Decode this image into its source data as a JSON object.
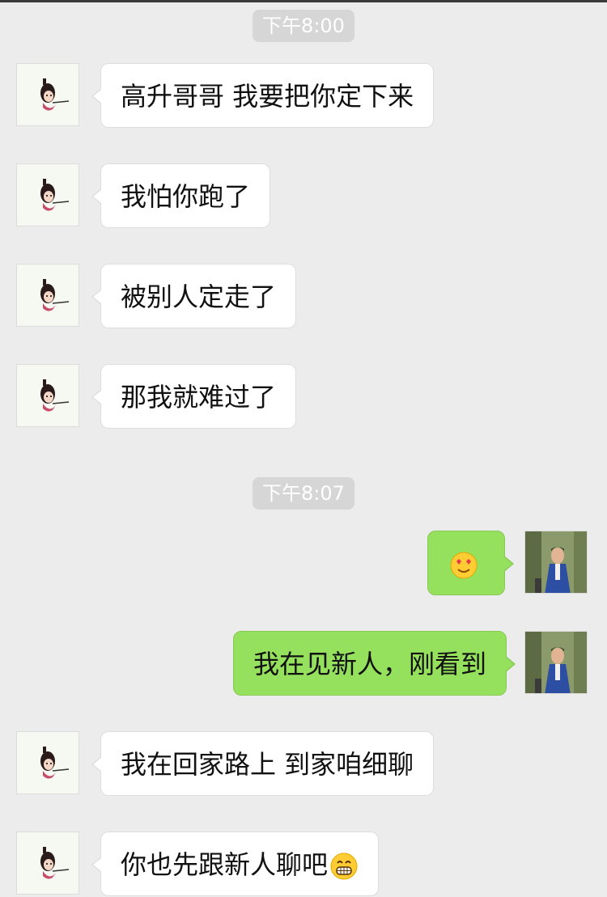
{
  "colors": {
    "background": "#ececec",
    "bubble_in": "#ffffff",
    "bubble_out": "#95e15d",
    "timestamp_bg": "#d6d6d6"
  },
  "timestamps": [
    "下午8:00",
    "下午8:07"
  ],
  "messages": [
    {
      "side": "left",
      "text": "高升哥哥 我要把你定下来"
    },
    {
      "side": "left",
      "text": "我怕你跑了"
    },
    {
      "side": "left",
      "text": "被别人定走了"
    },
    {
      "side": "left",
      "text": "那我就难过了"
    },
    {
      "side": "right",
      "text": "",
      "emoji": "heart-eyes-emoji"
    },
    {
      "side": "right",
      "text": "我在见新人，刚看到"
    },
    {
      "side": "left",
      "text": "我在回家路上 到家咱细聊"
    },
    {
      "side": "left",
      "text": "你也先跟新人聊吧",
      "emoji": "grin-emoji"
    }
  ],
  "avatars": {
    "incoming": "cartoon-girl-avatar",
    "outgoing": "man-in-blue-suit-avatar"
  }
}
